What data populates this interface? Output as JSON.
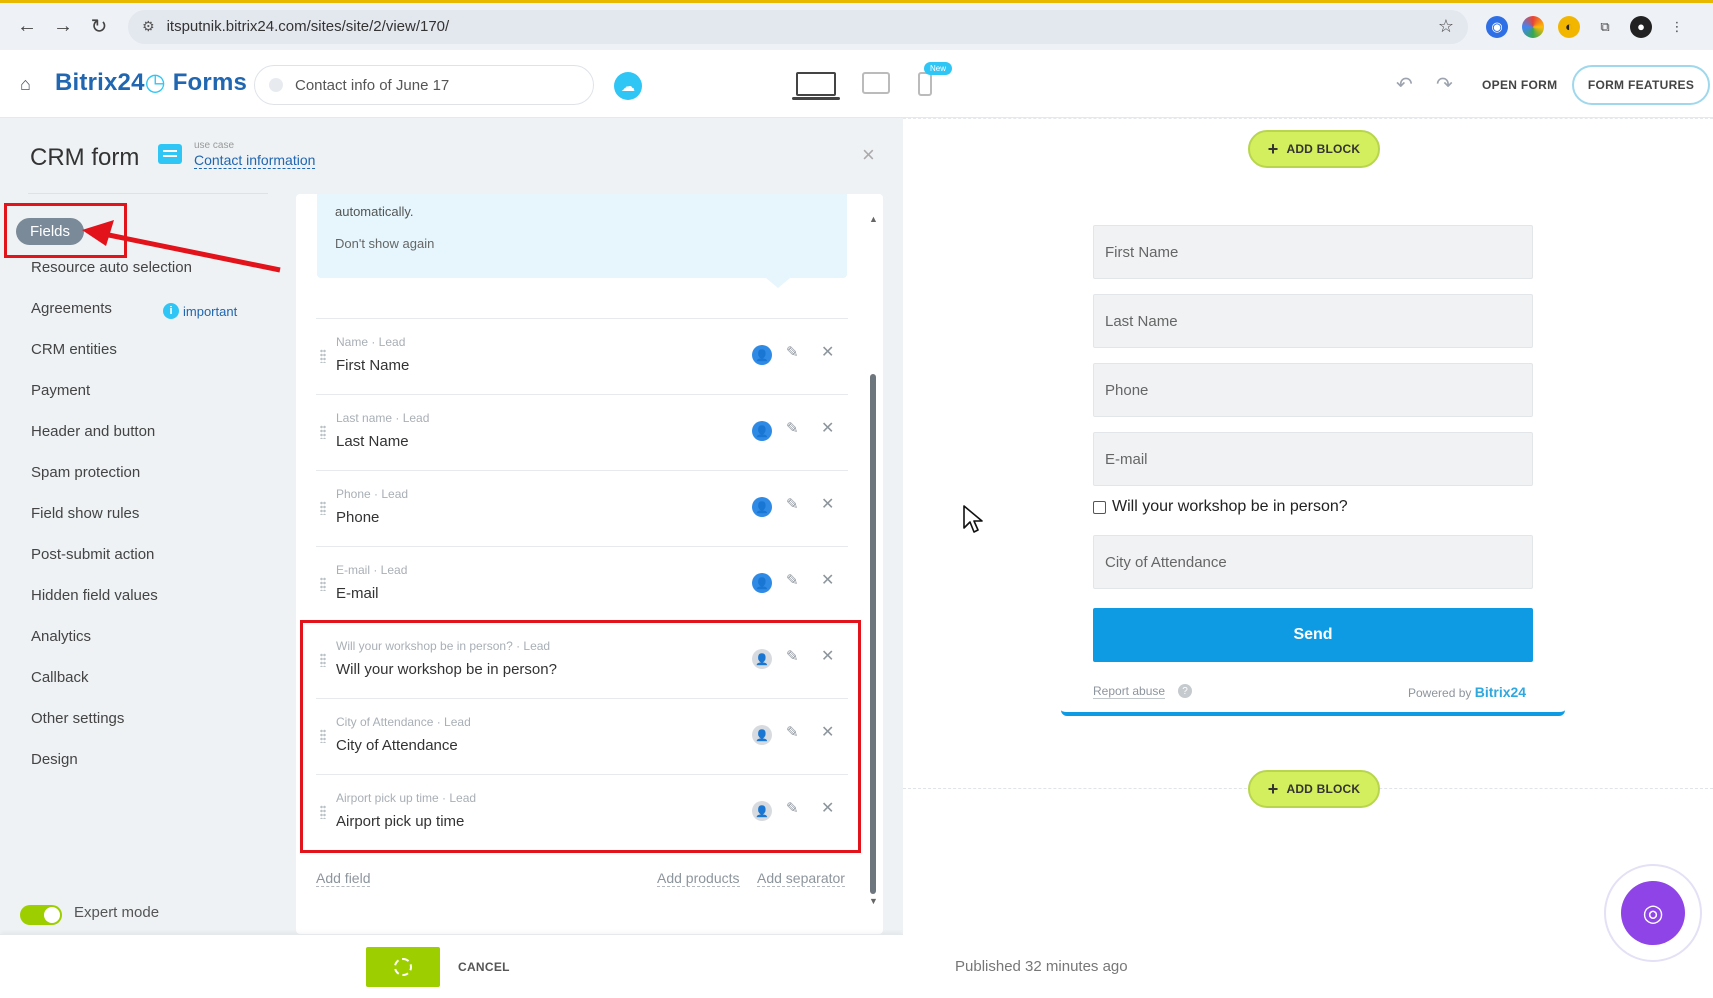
{
  "browser": {
    "url": "itsputnik.bitrix24.com/sites/site/2/view/170/"
  },
  "header": {
    "logo_bitrix": "Bitrix24",
    "logo_forms": "Forms",
    "form_name": "Contact info of June 17",
    "new_badge": "New",
    "open_form": "OPEN FORM",
    "form_features": "FORM FEATURES"
  },
  "settings": {
    "title": "CRM form",
    "use_case_caption": "use case",
    "use_case_link": "Contact information",
    "menu": [
      "Fields",
      "Resource auto selection",
      "Agreements",
      "CRM entities",
      "Payment",
      "Header and button",
      "Spam protection",
      "Field show rules",
      "Post-submit action",
      "Hidden field values",
      "Analytics",
      "Callback",
      "Other settings",
      "Design"
    ],
    "important_badge": "important",
    "expert_mode": "Expert mode"
  },
  "fields_panel": {
    "hint_text": "automatically.",
    "hint_dismiss": "Don't show again",
    "fields": [
      {
        "caption": "Name · Lead",
        "label": "First Name"
      },
      {
        "caption": "Last name · Lead",
        "label": "Last Name"
      },
      {
        "caption": "Phone · Lead",
        "label": "Phone"
      },
      {
        "caption": "E-mail · Lead",
        "label": "E-mail"
      },
      {
        "caption": "Will your workshop be in person? · Lead",
        "label": "Will your workshop be in person?"
      },
      {
        "caption": "City of Attendance · Lead",
        "label": "City of Attendance"
      },
      {
        "caption": "Airport pick up time · Lead",
        "label": "Airport pick up time"
      }
    ],
    "add_field": "Add field",
    "add_products": "Add products",
    "add_separator": "Add separator"
  },
  "bottom_bar": {
    "cancel": "CANCEL"
  },
  "preview": {
    "add_block": "ADD BLOCK",
    "inputs": {
      "first_name": "First Name",
      "last_name": "Last Name",
      "phone": "Phone",
      "email": "E-mail",
      "city": "City of Attendance"
    },
    "checkbox_label": "Will your workshop be in person?",
    "send": "Send",
    "report_abuse": "Report abuse",
    "powered_by": "Powered by",
    "powered_brand": "Bitrix24",
    "published": "Published 32 minutes ago"
  },
  "colors": {
    "accent_blue": "#2fc6f6",
    "send_blue": "#0f9be3",
    "green": "#9dcf00",
    "annotation_red": "#e3131c"
  }
}
